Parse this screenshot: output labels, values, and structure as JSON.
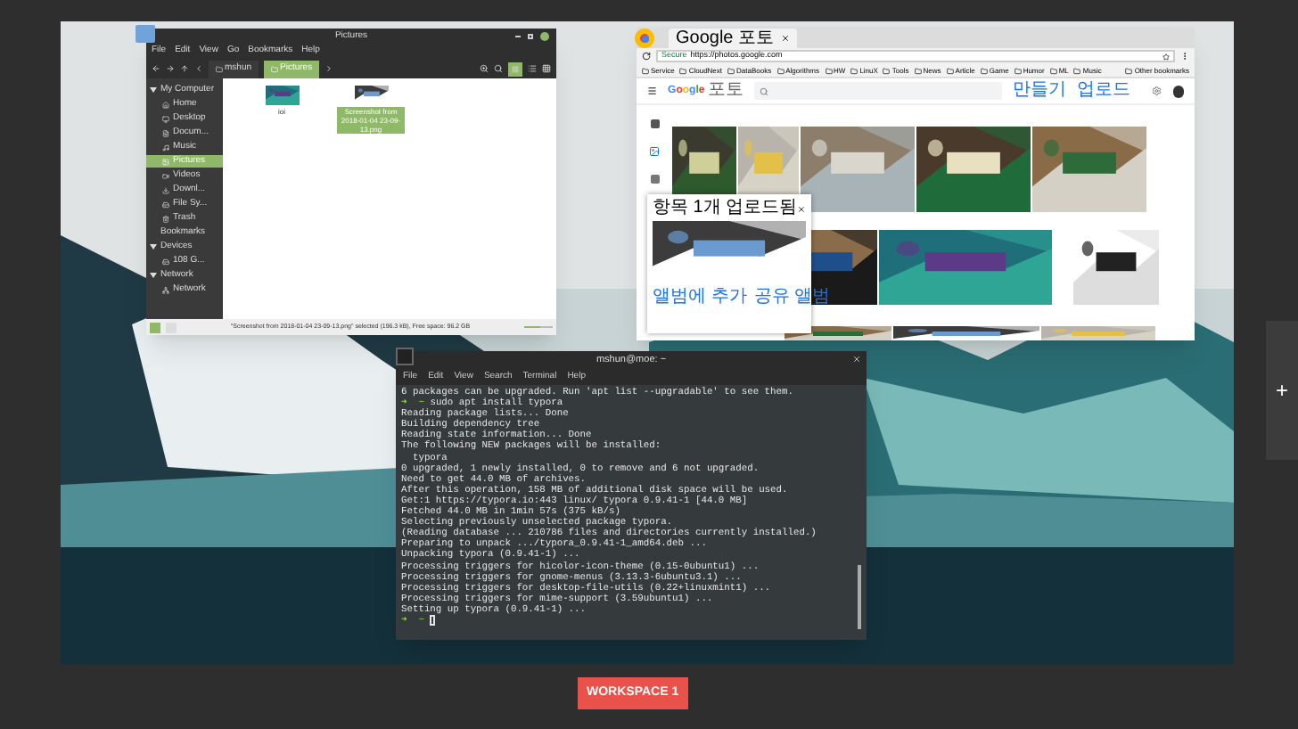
{
  "file_manager": {
    "title": "Pictures",
    "menu": [
      "File",
      "Edit",
      "View",
      "Go",
      "Bookmarks",
      "Help"
    ],
    "path": [
      {
        "label": "mshun",
        "selected": false
      },
      {
        "label": "Pictures",
        "selected": true
      }
    ],
    "sidebar": [
      {
        "kind": "header",
        "label": "My Computer"
      },
      {
        "kind": "item",
        "label": "Home",
        "selected": false
      },
      {
        "kind": "item",
        "label": "Desktop",
        "selected": false
      },
      {
        "kind": "item",
        "label": "Docum...",
        "selected": false
      },
      {
        "kind": "item",
        "label": "Music",
        "selected": false
      },
      {
        "kind": "item",
        "label": "Pictures",
        "selected": true
      },
      {
        "kind": "item",
        "label": "Videos",
        "selected": false
      },
      {
        "kind": "item",
        "label": "Downl...",
        "selected": false
      },
      {
        "kind": "item",
        "label": "File Sy...",
        "selected": false
      },
      {
        "kind": "item",
        "label": "Trash",
        "selected": false
      },
      {
        "kind": "section",
        "label": "Bookmarks"
      },
      {
        "kind": "header",
        "label": "Devices"
      },
      {
        "kind": "item",
        "label": "108 G...",
        "selected": false
      },
      {
        "kind": "header",
        "label": "Network"
      },
      {
        "kind": "item",
        "label": "Network",
        "selected": false
      }
    ],
    "files": [
      {
        "name": "ioi",
        "selected": false
      },
      {
        "name": "Screenshot from 2018-01-04 23-09-13.png",
        "selected": true
      }
    ],
    "zoom_slider": {
      "level": 0.55
    },
    "status": "\"Screenshot from 2018-01-04 23-09-13.png\" selected (196.3 kB), Free space: 96.2 GB"
  },
  "browser": {
    "tab": "Google 포토",
    "secure": "Secure",
    "url": "https://photos.google.com",
    "bookmarks": [
      "Service",
      "CloudNext",
      "DataBooks",
      "Algorithms",
      "HW",
      "LinuX",
      "Tools",
      "News",
      "Article",
      "Game",
      "Humor",
      "ML",
      "Music"
    ],
    "other_bookmarks": "Other bookmarks",
    "logo": "Google",
    "app_name": "포토",
    "actions": [
      "만들기",
      "업로드"
    ],
    "popup": {
      "title": "항목 1개 업로드됨",
      "actions": [
        "앨범에 추가",
        "공유 앨범"
      ]
    }
  },
  "terminal": {
    "title": "mshun@moe: ~",
    "menu": [
      "File",
      "Edit",
      "View",
      "Search",
      "Terminal",
      "Help"
    ],
    "lines": [
      {
        "kind": "output",
        "text": "6 packages can be upgraded. Run 'apt list --upgradable' to see them."
      },
      {
        "kind": "prompt",
        "prompt": "➜  ~",
        "text": "sudo apt install typora"
      },
      {
        "kind": "output",
        "text": "Reading package lists... Done"
      },
      {
        "kind": "output",
        "text": "Building dependency tree"
      },
      {
        "kind": "output",
        "text": "Reading state information... Done"
      },
      {
        "kind": "output",
        "text": "The following NEW packages will be installed:"
      },
      {
        "kind": "output",
        "text": "  typora"
      },
      {
        "kind": "output",
        "text": "0 upgraded, 1 newly installed, 0 to remove and 6 not upgraded."
      },
      {
        "kind": "output",
        "text": "Need to get 44.0 MB of archives."
      },
      {
        "kind": "output",
        "text": "After this operation, 158 MB of additional disk space will be used."
      },
      {
        "kind": "output",
        "text": "Get:1 https://typora.io:443 linux/ typora 0.9.41-1 [44.0 MB]"
      },
      {
        "kind": "output",
        "text": "Fetched 44.0 MB in 1min 57s (375 kB/s)"
      },
      {
        "kind": "output",
        "text": "Selecting previously unselected package typora."
      },
      {
        "kind": "output",
        "text": "(Reading database ... 210786 files and directories currently installed.)"
      },
      {
        "kind": "output",
        "text": "Preparing to unpack .../typora_0.9.41-1_amd64.deb ..."
      },
      {
        "kind": "output",
        "text": "Unpacking typora (0.9.41-1) ..."
      },
      {
        "kind": "output",
        "text": "Processing triggers for hicolor-icon-theme (0.15-0ubuntu1) ..."
      },
      {
        "kind": "output",
        "text": "Processing triggers for gnome-menus (3.13.3-6ubuntu3.1) ..."
      },
      {
        "kind": "output",
        "text": "Processing triggers for desktop-file-utils (0.22+linuxmint1) ..."
      },
      {
        "kind": "output",
        "text": "Processing triggers for mime-support (3.59ubuntu1) ..."
      },
      {
        "kind": "output",
        "text": "Setting up typora (0.9.41-1) ..."
      },
      {
        "kind": "prompt",
        "prompt": "➜  ~",
        "cursor": true
      }
    ]
  },
  "add_workspace": "+",
  "workspace": {
    "label": "WORKSPACE 1"
  }
}
